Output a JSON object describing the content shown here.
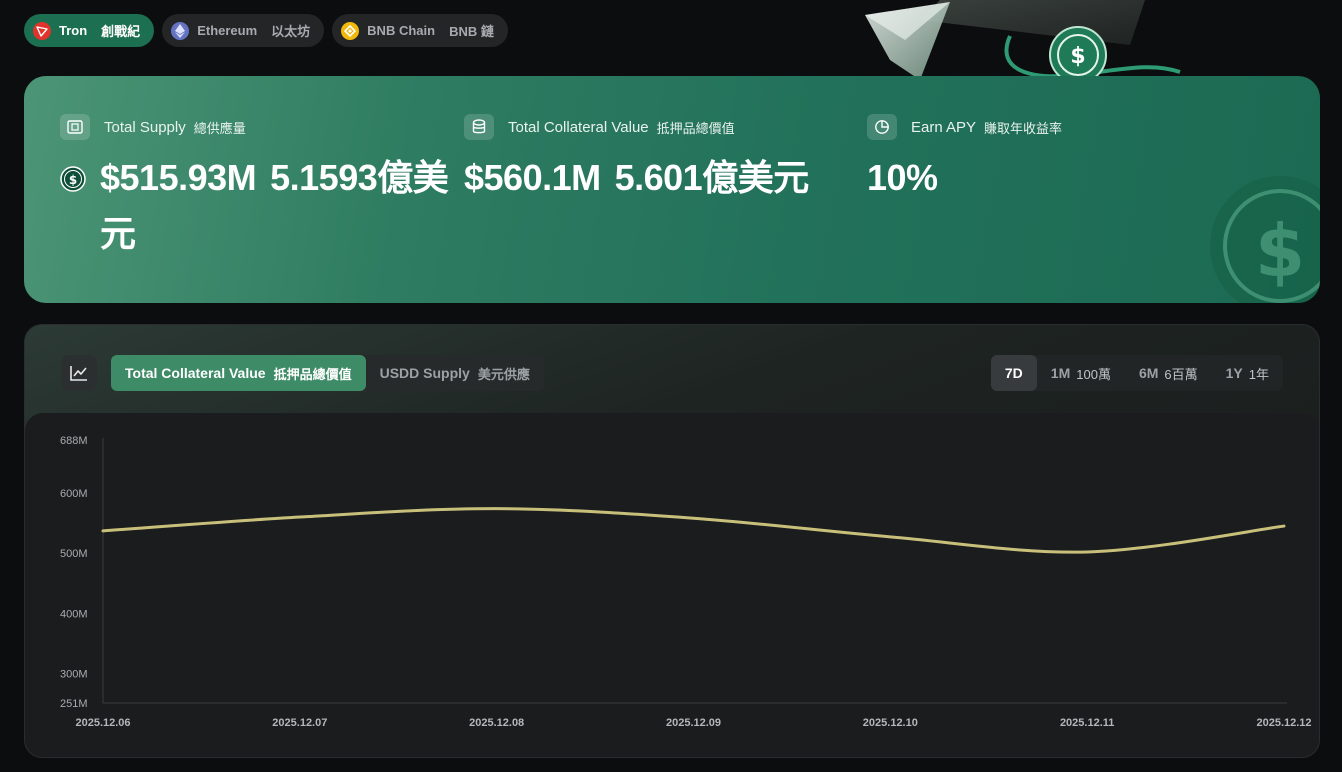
{
  "chains": [
    {
      "name": "Tron",
      "cn": "創戰紀",
      "icon": "tron-icon",
      "color": "#e0332c",
      "active": true
    },
    {
      "name": "Ethereum",
      "cn": "以太坊",
      "icon": "ethereum-icon",
      "color": "#6573c3",
      "active": false
    },
    {
      "name": "BNB Chain",
      "cn": "BNB 鏈",
      "icon": "bnb-icon",
      "color": "#f0b90b",
      "active": false
    }
  ],
  "stats": {
    "supply": {
      "label": "Total Supply",
      "cn": "總供應量",
      "value": "$515.93M",
      "value_cn": "5.1593億美元",
      "icon": "supply-icon"
    },
    "collateral": {
      "label": "Total Collateral Value",
      "cn": "抵押品總價值",
      "value": "$560.1M",
      "value_cn": "5.601億美元",
      "icon": "database-icon"
    },
    "apy": {
      "label": "Earn APY",
      "cn": "賺取年收益率",
      "value": "10%",
      "icon": "pie-chart-icon"
    }
  },
  "chart_tabs": [
    {
      "label": "Total Collateral Value",
      "cn": "抵押品總價值",
      "active": true
    },
    {
      "label": "USDD Supply",
      "cn": "美元供應",
      "active": false
    }
  ],
  "ranges": [
    {
      "label": "7D",
      "cn": "",
      "active": true
    },
    {
      "label": "1M",
      "cn": "100萬",
      "active": false
    },
    {
      "label": "6M",
      "cn": "6百萬",
      "active": false
    },
    {
      "label": "1Y",
      "cn": "1年",
      "active": false
    }
  ],
  "colors": {
    "accent": "#3e8b67",
    "line": "#c8c07a"
  },
  "chart_data": {
    "type": "line",
    "x": [
      "2025.12.06",
      "2025.12.07",
      "2025.12.08",
      "2025.12.09",
      "2025.12.10",
      "2025.12.11",
      "2025.12.12"
    ],
    "series": [
      {
        "values": [
          537,
          560,
          574,
          558,
          527,
          502,
          545
        ]
      }
    ],
    "yticks": [
      "688M",
      "600M",
      "500M",
      "400M",
      "300M",
      "251M"
    ],
    "ytick_values": [
      688,
      600,
      500,
      400,
      300,
      251
    ],
    "ylim": [
      251,
      688
    ],
    "grid": false
  }
}
